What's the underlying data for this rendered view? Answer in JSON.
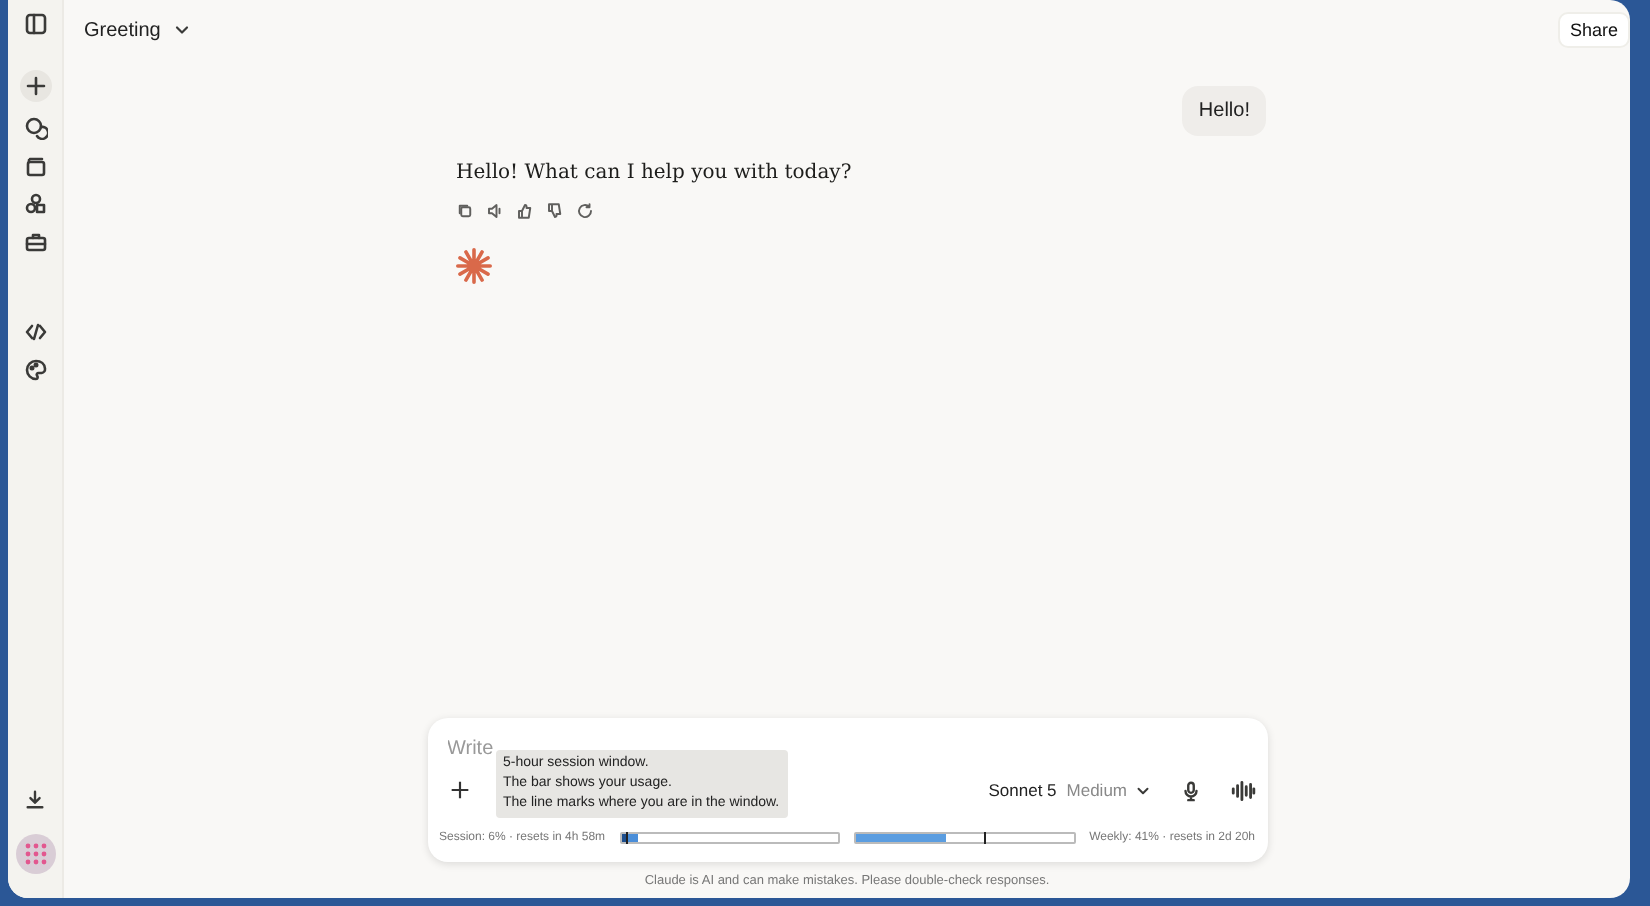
{
  "header": {
    "title": "Greeting",
    "share": "Share"
  },
  "sidebar": {
    "items": [
      {
        "kind": "new"
      },
      {
        "kind": "chats"
      },
      {
        "kind": "projects"
      },
      {
        "kind": "artifacts"
      },
      {
        "kind": "tools"
      },
      {
        "kind": "gap"
      },
      {
        "kind": "code"
      },
      {
        "kind": "palette"
      }
    ]
  },
  "conversation": [
    {
      "kind": "user",
      "text": "Hello!"
    },
    {
      "kind": "assistant",
      "text": "Hello! What can I help you with today?"
    }
  ],
  "composer": {
    "placeholder": "Write",
    "model": "Sonnet 5",
    "effort": "Medium",
    "tooltip": [
      "5-hour session window.",
      "The bar shows your usage.",
      "The line marks where you are in the window."
    ],
    "usage": [
      {
        "kind": "session",
        "label": "Session: 6% · resets in 4h 58m",
        "level": 0.06,
        "window_marker": {
          "level": 0.02
        }
      },
      {
        "kind": "weekly",
        "label": "Weekly: 41% · resets in 2d 20h",
        "level": 0.41,
        "window_marker": {
          "level": 0.59
        }
      }
    ]
  },
  "disclaimer": "Claude is AI and can make mistakes. Please double-check responses."
}
